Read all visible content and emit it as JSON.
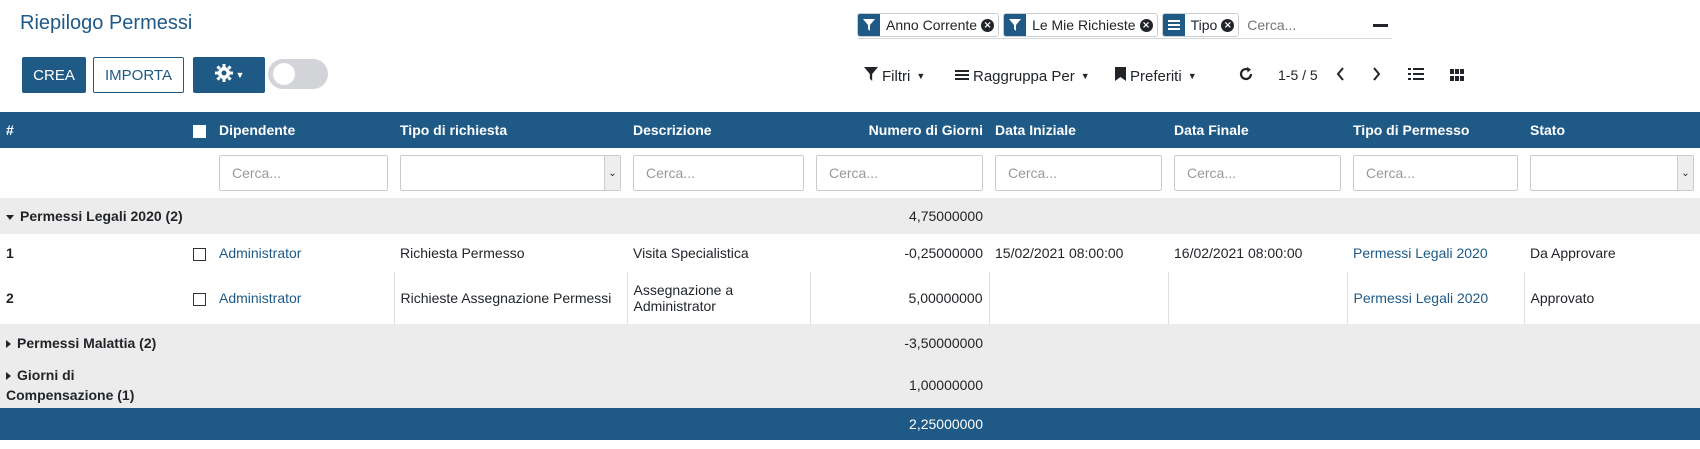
{
  "title": "Riepilogo Permessi",
  "search": {
    "facets": [
      {
        "icon": "filter-icon",
        "label": "Anno Corrente"
      },
      {
        "icon": "filter-icon",
        "label": "Le Mie Richieste"
      },
      {
        "icon": "list-icon",
        "label": "Tipo"
      }
    ],
    "placeholder": "Cerca..."
  },
  "buttons": {
    "create": "CREA",
    "import": "IMPORTA"
  },
  "controls": {
    "filters": "Filtri",
    "group_by": "Raggruppa Per",
    "favorites": "Preferiti",
    "pager": "1-5 / 5"
  },
  "table": {
    "columns": [
      "#",
      "Dipendente",
      "Tipo di richiesta",
      "Descrizione",
      "Numero di Giorni",
      "Data Iniziale",
      "Data Finale",
      "Tipo di Permesso",
      "Stato"
    ],
    "filter_placeholder": "Cerca...",
    "groups": [
      {
        "name": "Permessi Legali 2020 (2)",
        "total": "4,75000000",
        "expanded": true,
        "rows": [
          {
            "num": "1",
            "employee": "Administrator",
            "request_type": "Richiesta Permesso",
            "description": "Visita Specialistica",
            "days": "-0,25000000",
            "start": "15/02/2021 08:00:00",
            "end": "16/02/2021 08:00:00",
            "leave_type": "Permessi Legali 2020",
            "status": "Da Approvare"
          },
          {
            "num": "2",
            "employee": "Administrator",
            "request_type": "Richieste Assegnazione Permessi",
            "description": "Assegnazione a Administrator",
            "days": "5,00000000",
            "start": "",
            "end": "",
            "leave_type": "Permessi Legali 2020",
            "status": "Approvato"
          }
        ]
      },
      {
        "name": "Permessi Malattia (2)",
        "total": "-3,50000000",
        "expanded": false
      },
      {
        "name": "Giorni di Compensazione (1)",
        "total": "1,00000000",
        "expanded": false
      }
    ],
    "grand_total": "2,25000000"
  },
  "colors": {
    "primary": "#1f5a86",
    "group_bg": "#ececec"
  }
}
